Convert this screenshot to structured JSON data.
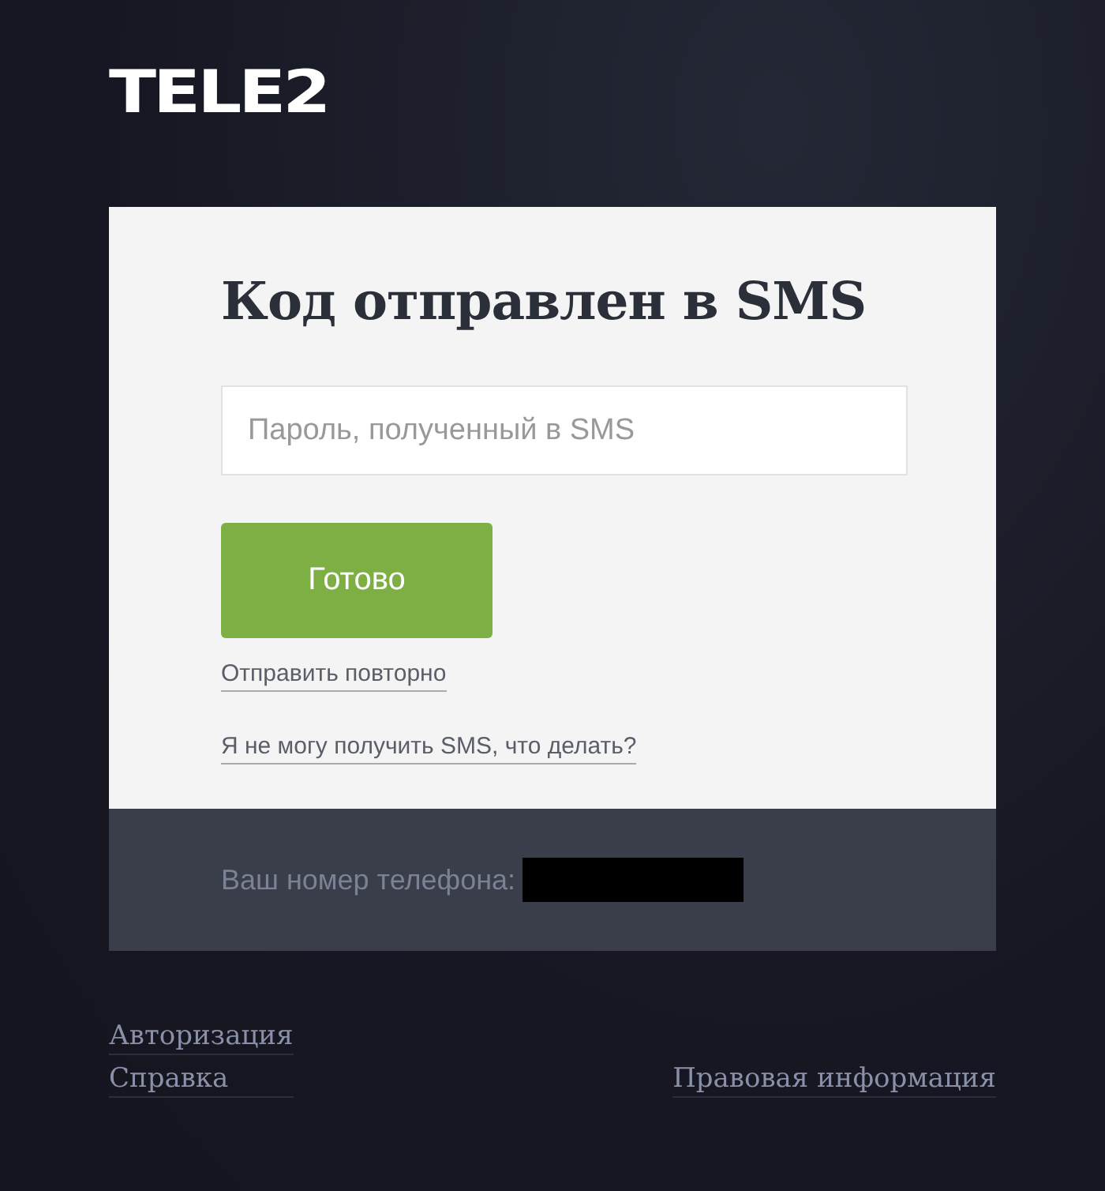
{
  "logo": {
    "text": "TELE2"
  },
  "card": {
    "title": "Код отправлен в SMS",
    "password_field": {
      "placeholder": "Пароль, полученный в SMS"
    },
    "submit_button": "Готово",
    "links": [
      "Отправить повторно",
      "Я не могу получить SMS, что делать?"
    ],
    "phone_label": "Ваш номер телефона:",
    "phone_hidden": true
  },
  "footer": {
    "left_links": [
      "Авторизация",
      "Справка"
    ],
    "right_link": "Правовая информация"
  }
}
